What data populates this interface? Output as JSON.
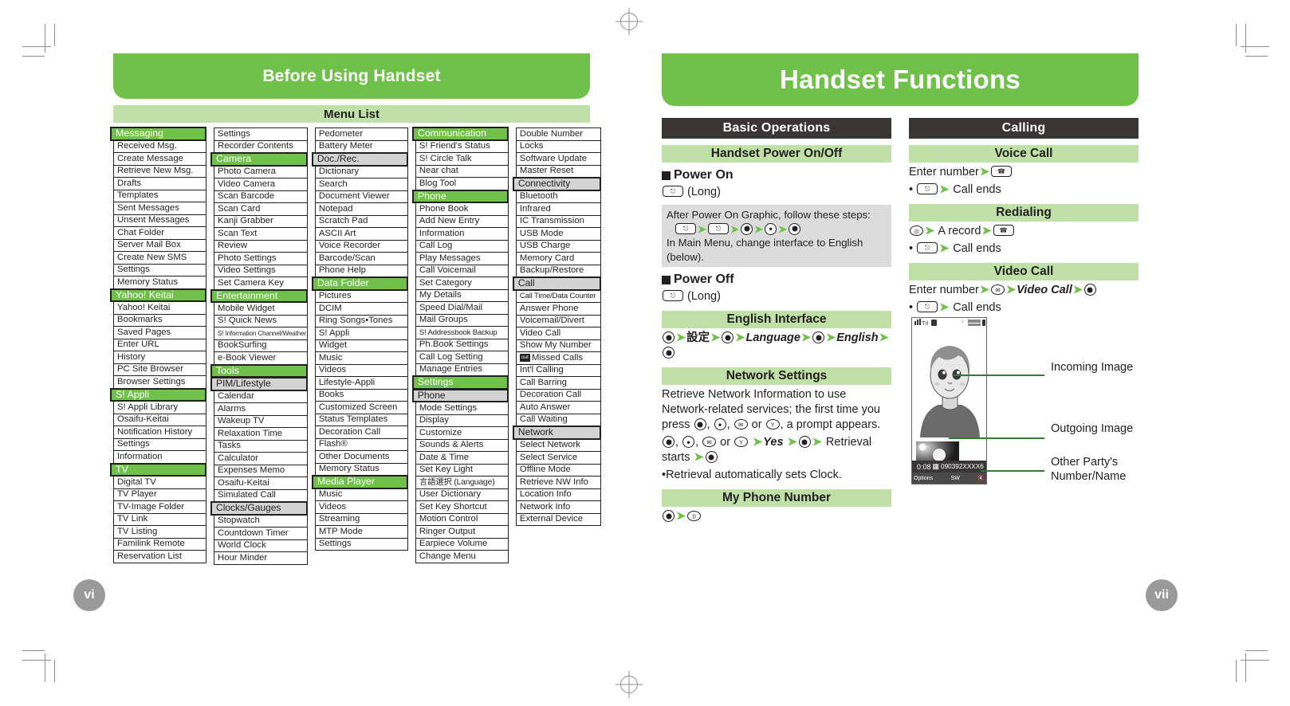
{
  "left_page": {
    "banner": "Before Using Handset",
    "section_title": "Menu List",
    "page_number": "vi",
    "columns": [
      {
        "id": "col1",
        "items": [
          {
            "t": "Messaging",
            "k": "h1"
          },
          {
            "t": "Received Msg.",
            "k": "i"
          },
          {
            "t": "Create Message",
            "k": "i"
          },
          {
            "t": "Retrieve New Msg.",
            "k": "i"
          },
          {
            "t": "Drafts",
            "k": "i"
          },
          {
            "t": "Templates",
            "k": "i"
          },
          {
            "t": "Sent Messages",
            "k": "i"
          },
          {
            "t": "Unsent Messages",
            "k": "i"
          },
          {
            "t": "Chat Folder",
            "k": "i"
          },
          {
            "t": "Server Mail Box",
            "k": "i"
          },
          {
            "t": "Create New SMS",
            "k": "i"
          },
          {
            "t": "Settings",
            "k": "i"
          },
          {
            "t": "Memory Status",
            "k": "i"
          },
          {
            "t": "Yahoo! Keitai",
            "k": "h1"
          },
          {
            "t": "Yahoo! Keitai",
            "k": "i"
          },
          {
            "t": "Bookmarks",
            "k": "i"
          },
          {
            "t": "Saved Pages",
            "k": "i"
          },
          {
            "t": "Enter URL",
            "k": "i"
          },
          {
            "t": "History",
            "k": "i"
          },
          {
            "t": "PC Site Browser",
            "k": "i"
          },
          {
            "t": "Browser Settings",
            "k": "i"
          },
          {
            "t": "S! Appli",
            "k": "h1"
          },
          {
            "t": "S! Appli Library",
            "k": "i"
          },
          {
            "t": "Osaifu-Keitai",
            "k": "i"
          },
          {
            "t": "Notification History",
            "k": "i"
          },
          {
            "t": "Settings",
            "k": "i"
          },
          {
            "t": "Information",
            "k": "i"
          },
          {
            "t": "TV",
            "k": "h1"
          },
          {
            "t": "Digital TV",
            "k": "i"
          },
          {
            "t": "TV Player",
            "k": "i"
          },
          {
            "t": "TV-Image Folder",
            "k": "i"
          },
          {
            "t": "TV Link",
            "k": "i"
          },
          {
            "t": "TV Listing",
            "k": "i"
          },
          {
            "t": "Familink Remote",
            "k": "i"
          },
          {
            "t": "Reservation List",
            "k": "i"
          }
        ]
      },
      {
        "id": "col2",
        "items": [
          {
            "t": "Settings",
            "k": "i"
          },
          {
            "t": "Recorder Contents",
            "k": "i"
          },
          {
            "t": "Camera",
            "k": "h1"
          },
          {
            "t": "Photo Camera",
            "k": "i"
          },
          {
            "t": "Video Camera",
            "k": "i"
          },
          {
            "t": "Scan Barcode",
            "k": "i"
          },
          {
            "t": "Scan Card",
            "k": "i"
          },
          {
            "t": "Kanji Grabber",
            "k": "i"
          },
          {
            "t": "Scan Text",
            "k": "i"
          },
          {
            "t": "Review",
            "k": "i"
          },
          {
            "t": "Photo Settings",
            "k": "i"
          },
          {
            "t": "Video Settings",
            "k": "i"
          },
          {
            "t": "Set Camera Key",
            "k": "i"
          },
          {
            "t": "Entertainment",
            "k": "h1"
          },
          {
            "t": "Mobile Widget",
            "k": "i"
          },
          {
            "t": "S! Quick News",
            "k": "i"
          },
          {
            "t": "S! Information Channel/Weather",
            "k": "tiny"
          },
          {
            "t": "BookSurfing",
            "k": "i"
          },
          {
            "t": "e-Book Viewer",
            "k": "i"
          },
          {
            "t": "Tools",
            "k": "h1"
          },
          {
            "t": "PIM/Lifestyle",
            "k": "h2"
          },
          {
            "t": "Calendar",
            "k": "i"
          },
          {
            "t": "Alarms",
            "k": "i"
          },
          {
            "t": "Wakeup TV",
            "k": "i"
          },
          {
            "t": "Relaxation Time",
            "k": "i"
          },
          {
            "t": "Tasks",
            "k": "i"
          },
          {
            "t": "Calculator",
            "k": "i"
          },
          {
            "t": "Expenses Memo",
            "k": "i"
          },
          {
            "t": "Osaifu-Keitai",
            "k": "i"
          },
          {
            "t": "Simulated Call",
            "k": "i"
          },
          {
            "t": "Clocks/Gauges",
            "k": "h2"
          },
          {
            "t": "Stopwatch",
            "k": "i"
          },
          {
            "t": "Countdown Timer",
            "k": "i"
          },
          {
            "t": "World Clock",
            "k": "i"
          },
          {
            "t": "Hour Minder",
            "k": "i"
          }
        ]
      },
      {
        "id": "col3",
        "items": [
          {
            "t": "Pedometer",
            "k": "i"
          },
          {
            "t": "Battery Meter",
            "k": "i"
          },
          {
            "t": "Doc./Rec.",
            "k": "h2"
          },
          {
            "t": "Dictionary",
            "k": "i"
          },
          {
            "t": "Search",
            "k": "i"
          },
          {
            "t": "Document Viewer",
            "k": "i"
          },
          {
            "t": "Notepad",
            "k": "i"
          },
          {
            "t": "Scratch Pad",
            "k": "i"
          },
          {
            "t": "ASCII Art",
            "k": "i"
          },
          {
            "t": "Voice Recorder",
            "k": "i"
          },
          {
            "t": "Barcode/Scan",
            "k": "i"
          },
          {
            "t": "Phone Help",
            "k": "i"
          },
          {
            "t": "Data Folder",
            "k": "h1"
          },
          {
            "t": "Pictures",
            "k": "i"
          },
          {
            "t": "DCIM",
            "k": "i"
          },
          {
            "t": "Ring Songs•Tones",
            "k": "i"
          },
          {
            "t": "S! Appli",
            "k": "i"
          },
          {
            "t": "Widget",
            "k": "i"
          },
          {
            "t": "Music",
            "k": "i"
          },
          {
            "t": "Videos",
            "k": "i"
          },
          {
            "t": "Lifestyle-Appli",
            "k": "i"
          },
          {
            "t": "Books",
            "k": "i"
          },
          {
            "t": "Customized Screen",
            "k": "i"
          },
          {
            "t": "Status Templates",
            "k": "i"
          },
          {
            "t": "Decoration Call",
            "k": "i"
          },
          {
            "t": "Flash®",
            "k": "i"
          },
          {
            "t": "Other Documents",
            "k": "i"
          },
          {
            "t": "Memory Status",
            "k": "i"
          },
          {
            "t": "Media Player",
            "k": "h1"
          },
          {
            "t": "Music",
            "k": "i"
          },
          {
            "t": "Videos",
            "k": "i"
          },
          {
            "t": "Streaming",
            "k": "i"
          },
          {
            "t": "MTP Mode",
            "k": "i"
          },
          {
            "t": "Settings",
            "k": "i"
          }
        ]
      },
      {
        "id": "col4",
        "items": [
          {
            "t": "Communication",
            "k": "h1"
          },
          {
            "t": "S! Friend's Status",
            "k": "i"
          },
          {
            "t": "S! Circle Talk",
            "k": "i"
          },
          {
            "t": "Near chat",
            "k": "i"
          },
          {
            "t": "Blog Tool",
            "k": "i"
          },
          {
            "t": "Phone",
            "k": "h1"
          },
          {
            "t": "Phone Book",
            "k": "i"
          },
          {
            "t": "Add New Entry",
            "k": "i"
          },
          {
            "t": "Information",
            "k": "i"
          },
          {
            "t": "Call Log",
            "k": "i"
          },
          {
            "t": "Play Messages",
            "k": "i"
          },
          {
            "t": "Call Voicemail",
            "k": "i"
          },
          {
            "t": "Set Category",
            "k": "i"
          },
          {
            "t": "My Details",
            "k": "i"
          },
          {
            "t": "Speed Dial/Mail",
            "k": "i"
          },
          {
            "t": "Mail Groups",
            "k": "i"
          },
          {
            "t": "S! Addressbook Backup",
            "k": "small"
          },
          {
            "t": "Ph.Book Settings",
            "k": "i"
          },
          {
            "t": "Call Log Setting",
            "k": "i"
          },
          {
            "t": "Manage Entries",
            "k": "i"
          },
          {
            "t": "Settings",
            "k": "h1"
          },
          {
            "t": "Phone",
            "k": "h2"
          },
          {
            "t": "Mode Settings",
            "k": "i"
          },
          {
            "t": "Display",
            "k": "i"
          },
          {
            "t": "Customize",
            "k": "i"
          },
          {
            "t": "Sounds & Alerts",
            "k": "i"
          },
          {
            "t": "Date & Time",
            "k": "i"
          },
          {
            "t": "Set Key Light",
            "k": "i"
          },
          {
            "t": "言語選択 (Language)",
            "k": "med"
          },
          {
            "t": "User Dictionary",
            "k": "i"
          },
          {
            "t": "Set Key Shortcut",
            "k": "i"
          },
          {
            "t": "Motion Control",
            "k": "i"
          },
          {
            "t": "Ringer Output",
            "k": "i"
          },
          {
            "t": "Earpiece Volume",
            "k": "i"
          },
          {
            "t": "Change Menu",
            "k": "i"
          }
        ]
      },
      {
        "id": "col5",
        "items": [
          {
            "t": "Double Number",
            "k": "i"
          },
          {
            "t": "Locks",
            "k": "i"
          },
          {
            "t": "Software Update",
            "k": "i"
          },
          {
            "t": "Master Reset",
            "k": "i"
          },
          {
            "t": "Connectivity",
            "k": "h2"
          },
          {
            "t": "Bluetooth",
            "k": "i"
          },
          {
            "t": "Infrared",
            "k": "i"
          },
          {
            "t": "IC Transmission",
            "k": "i"
          },
          {
            "t": "USB Mode",
            "k": "i"
          },
          {
            "t": "USB Charge",
            "k": "i"
          },
          {
            "t": "Memory Card",
            "k": "i"
          },
          {
            "t": "Backup/Restore",
            "k": "i"
          },
          {
            "t": "Call",
            "k": "h2"
          },
          {
            "t": "Call Time/Data Counter",
            "k": "small"
          },
          {
            "t": "Answer Phone",
            "k": "i"
          },
          {
            "t": "Voicemail/Divert",
            "k": "i"
          },
          {
            "t": "Video Call",
            "k": "i"
          },
          {
            "t": "Show My Number",
            "k": "i"
          },
          {
            "t": "Missed Calls",
            "k": "i",
            "icon": "out"
          },
          {
            "t": "Int'l Calling",
            "k": "i"
          },
          {
            "t": "Call Barring",
            "k": "i"
          },
          {
            "t": "Decoration Call",
            "k": "i"
          },
          {
            "t": "Auto Answer",
            "k": "i"
          },
          {
            "t": "Call Waiting",
            "k": "i"
          },
          {
            "t": "Network",
            "k": "h2"
          },
          {
            "t": "Select Network",
            "k": "i"
          },
          {
            "t": "Select Service",
            "k": "i"
          },
          {
            "t": "Offline Mode",
            "k": "i"
          },
          {
            "t": "Retrieve NW Info",
            "k": "i"
          },
          {
            "t": "Location Info",
            "k": "i"
          },
          {
            "t": "Network Info",
            "k": "i"
          },
          {
            "t": "External Device",
            "k": "i"
          }
        ]
      }
    ]
  },
  "right_page": {
    "banner": "Handset Functions",
    "page_number": "vii",
    "col_left": {
      "header": "Basic Operations",
      "sec_power": "Handset Power On/Off",
      "power_on_label": "Power On",
      "power_on_key": "(Long)",
      "power_on_note_line1": "After Power On Graphic, follow these steps:",
      "power_on_note_line2": "In Main Menu, change interface to English",
      "power_on_note_line3": "(below).",
      "power_off_label": "Power Off",
      "power_off_key": "(Long)",
      "sec_english": "English Interface",
      "english_step_jp": "設定",
      "english_step_language": "Language",
      "english_step_english": "English",
      "sec_network": "Network Settings",
      "network_p1": "Retrieve Network Information to use Network-related services; the first time you press",
      "network_p1b": ", a prompt appears.",
      "network_yes": "Yes",
      "network_retrieval": "Retrieval starts",
      "network_or": "or",
      "network_bullet": "Retrieval automatically sets Clock.",
      "sec_myphone": "My Phone Number"
    },
    "col_right": {
      "header": "Calling",
      "sec_voice": "Voice Call",
      "voice_line1": "Enter number",
      "voice_line2": "Call ends",
      "sec_redial": "Redialing",
      "redial_line1": "A record",
      "redial_line2": "Call ends",
      "sec_video": "Video Call",
      "video_line1": "Enter number",
      "video_item": "Video Call",
      "video_line2": "Call ends",
      "callouts": [
        "Incoming Image",
        "Outgoing Image",
        "Other Party's Number/Name"
      ],
      "phone_screen": {
        "timer": "0:08",
        "number": "090392XXXX6",
        "softkey_left": "Options",
        "softkey_center": "SW",
        "softkey_right": "mute"
      }
    }
  },
  "colors": {
    "brand_green": "#6fc14a",
    "light_green": "#bfe0a6",
    "dark_bar": "#3a3636",
    "grey_header": "#d3d3d3",
    "arrow_green": "#6fc14a"
  }
}
